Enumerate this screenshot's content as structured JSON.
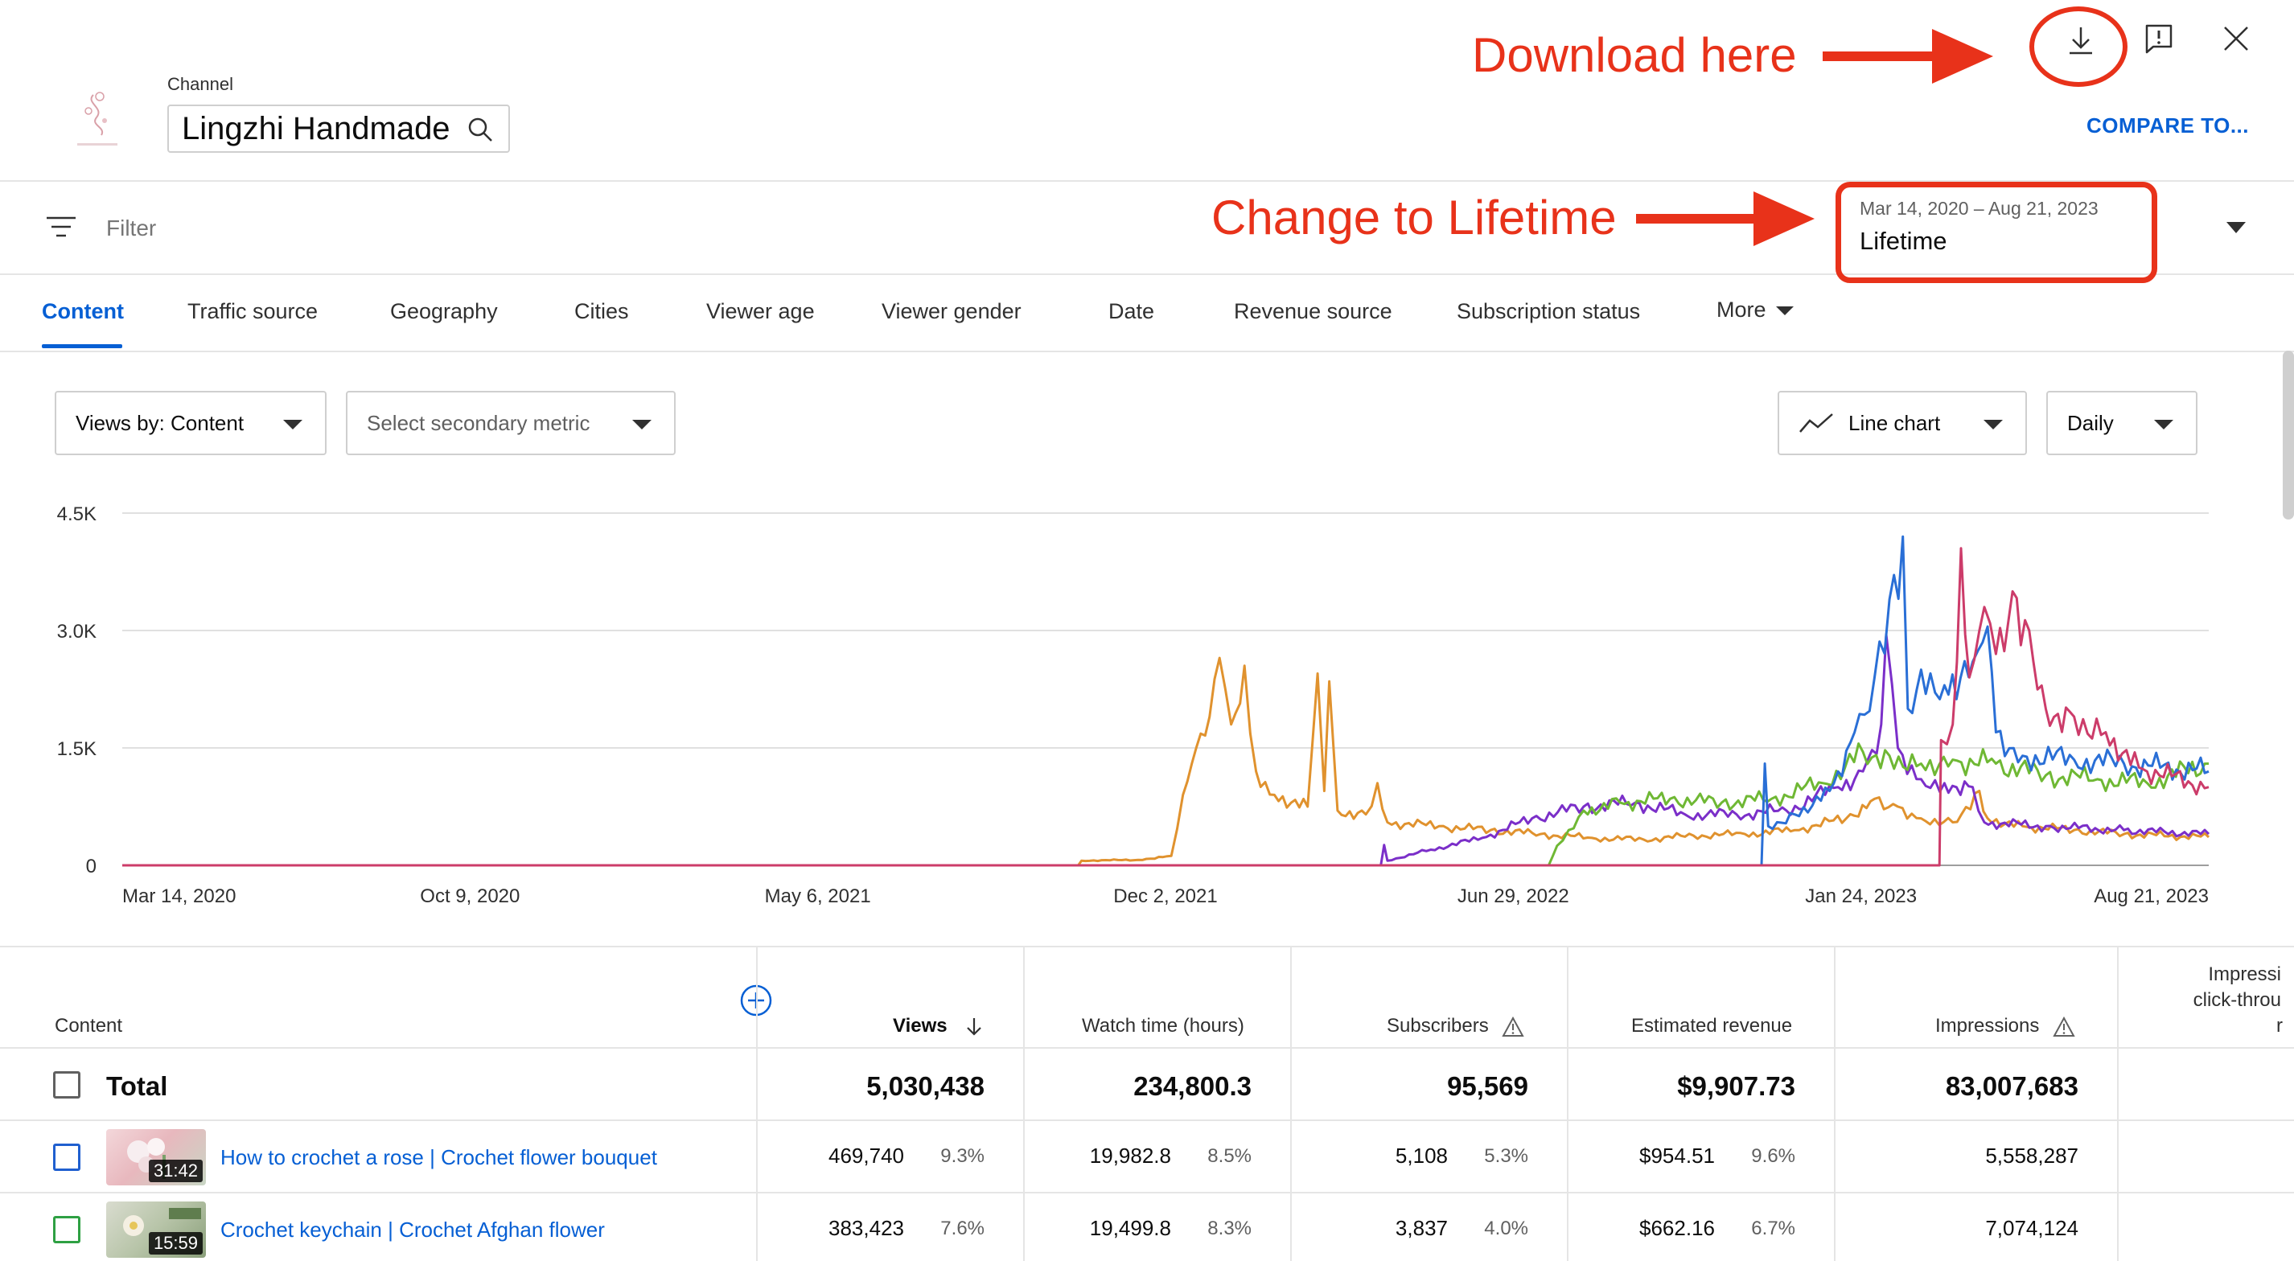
{
  "header": {
    "channel_caption": "Channel",
    "channel_name": "Lingzhi Handmade",
    "compare_label": "COMPARE TO..."
  },
  "annotations": {
    "download": "Download here",
    "lifetime": "Change to Lifetime"
  },
  "filterbar": {
    "filter_label": "Filter",
    "date_range": "Mar 14, 2020 – Aug 21, 2023",
    "date_value": "Lifetime"
  },
  "tabs": [
    {
      "label": "Content",
      "active": true
    },
    {
      "label": "Traffic source"
    },
    {
      "label": "Geography"
    },
    {
      "label": "Cities"
    },
    {
      "label": "Viewer age"
    },
    {
      "label": "Viewer gender"
    },
    {
      "label": "Date"
    },
    {
      "label": "Revenue source"
    },
    {
      "label": "Subscription status"
    },
    {
      "label": "More"
    }
  ],
  "controls": {
    "primary_metric": "Views by: Content",
    "secondary_metric": "Select secondary metric",
    "chart_type": "Line chart",
    "granularity": "Daily"
  },
  "colors": {
    "accent": "#065fd4",
    "annotation": "#e8321a",
    "series_orange": "#e0922e",
    "series_purple": "#7b2fc9",
    "series_green": "#6fb834",
    "series_blue": "#2a6fd6",
    "series_pink": "#cc3c6a"
  },
  "chart_data": {
    "type": "line",
    "x_tick_labels": [
      "Mar 14, 2020",
      "Oct 9, 2020",
      "May 6, 2021",
      "Dec 2, 2021",
      "Jun 29, 2022",
      "Jan 24, 2023",
      "Aug 21, 2023"
    ],
    "y_tick_labels": [
      "0",
      "1.5K",
      "3.0K",
      "4.5K"
    ],
    "ylim": [
      0,
      4500
    ],
    "x_range": [
      "2020-03-14",
      "2023-08-21"
    ],
    "grid": true,
    "series": [
      {
        "color": "orange",
        "points": [
          [
            "2020-03-14",
            0
          ],
          [
            "2021-10-10",
            0
          ],
          [
            "2021-10-12",
            60
          ],
          [
            "2021-11-15",
            70
          ],
          [
            "2021-12-05",
            120
          ],
          [
            "2021-12-12",
            900
          ],
          [
            "2021-12-20",
            1500
          ],
          [
            "2021-12-28",
            1900
          ],
          [
            "2022-01-03",
            2650
          ],
          [
            "2022-01-10",
            1800
          ],
          [
            "2022-01-18",
            2550
          ],
          [
            "2022-01-25",
            1200
          ],
          [
            "2022-02-05",
            900
          ],
          [
            "2022-02-25",
            750
          ],
          [
            "2022-03-03",
            2450
          ],
          [
            "2022-03-07",
            950
          ],
          [
            "2022-03-10",
            2350
          ],
          [
            "2022-03-15",
            700
          ],
          [
            "2022-04-01",
            650
          ],
          [
            "2022-04-08",
            1050
          ],
          [
            "2022-04-14",
            550
          ],
          [
            "2022-05-15",
            500
          ],
          [
            "2022-06-15",
            450
          ],
          [
            "2022-07-15",
            400
          ],
          [
            "2022-08-15",
            350
          ],
          [
            "2022-09-15",
            330
          ],
          [
            "2022-10-15",
            380
          ],
          [
            "2022-11-15",
            400
          ],
          [
            "2022-12-15",
            450
          ],
          [
            "2023-01-15",
            600
          ],
          [
            "2023-02-01",
            850
          ],
          [
            "2023-02-15",
            750
          ],
          [
            "2023-03-01",
            600
          ],
          [
            "2023-03-20",
            550
          ],
          [
            "2023-04-05",
            950
          ],
          [
            "2023-04-10",
            600
          ],
          [
            "2023-05-01",
            500
          ],
          [
            "2023-06-01",
            450
          ],
          [
            "2023-07-01",
            400
          ],
          [
            "2023-08-21",
            360
          ]
        ]
      },
      {
        "color": "purple",
        "points": [
          [
            "2020-03-14",
            0
          ],
          [
            "2022-04-10",
            0
          ],
          [
            "2022-04-12",
            260
          ],
          [
            "2022-04-14",
            60
          ],
          [
            "2022-05-10",
            200
          ],
          [
            "2022-06-10",
            350
          ],
          [
            "2022-07-10",
            600
          ],
          [
            "2022-08-10",
            750
          ],
          [
            "2022-09-10",
            800
          ],
          [
            "2022-10-10",
            650
          ],
          [
            "2022-11-10",
            650
          ],
          [
            "2022-12-10",
            700
          ],
          [
            "2023-01-10",
            1000
          ],
          [
            "2023-01-25",
            1200
          ],
          [
            "2023-02-05",
            1800
          ],
          [
            "2023-02-08",
            2950
          ],
          [
            "2023-02-15",
            1500
          ],
          [
            "2023-03-01",
            1100
          ],
          [
            "2023-03-15",
            1050
          ],
          [
            "2023-04-01",
            1000
          ],
          [
            "2023-04-08",
            550
          ],
          [
            "2023-05-15",
            500
          ],
          [
            "2023-07-01",
            450
          ],
          [
            "2023-08-21",
            400
          ]
        ]
      },
      {
        "color": "green",
        "points": [
          [
            "2020-03-14",
            0
          ],
          [
            "2022-07-20",
            0
          ],
          [
            "2022-07-25",
            250
          ],
          [
            "2022-08-01",
            450
          ],
          [
            "2022-08-10",
            700
          ],
          [
            "2022-09-01",
            800
          ],
          [
            "2022-10-01",
            850
          ],
          [
            "2022-11-01",
            800
          ],
          [
            "2022-12-01",
            850
          ],
          [
            "2023-01-01",
            1050
          ],
          [
            "2023-01-25",
            1450
          ],
          [
            "2023-02-10",
            1400
          ],
          [
            "2023-03-01",
            1300
          ],
          [
            "2023-03-20",
            1350
          ],
          [
            "2023-04-15",
            1300
          ],
          [
            "2023-05-15",
            1150
          ],
          [
            "2023-06-15",
            1100
          ],
          [
            "2023-07-15",
            1050
          ],
          [
            "2023-08-21",
            1300
          ]
        ]
      },
      {
        "color": "blue",
        "points": [
          [
            "2020-03-14",
            0
          ],
          [
            "2022-11-25",
            0
          ],
          [
            "2022-11-27",
            1300
          ],
          [
            "2022-11-29",
            500
          ],
          [
            "2022-12-15",
            650
          ],
          [
            "2023-01-05",
            950
          ],
          [
            "2023-01-20",
            1700
          ],
          [
            "2023-02-01",
            2400
          ],
          [
            "2023-02-10",
            3400
          ],
          [
            "2023-02-18",
            4200
          ],
          [
            "2023-02-21",
            2000
          ],
          [
            "2023-03-01",
            2500
          ],
          [
            "2023-03-15",
            2300
          ],
          [
            "2023-04-01",
            2600
          ],
          [
            "2023-04-10",
            3050
          ],
          [
            "2023-04-15",
            1700
          ],
          [
            "2023-05-01",
            1400
          ],
          [
            "2023-06-01",
            1350
          ],
          [
            "2023-07-01",
            1300
          ],
          [
            "2023-08-21",
            1200
          ]
        ]
      },
      {
        "color": "pink",
        "points": [
          [
            "2020-03-14",
            0
          ],
          [
            "2023-03-12",
            0
          ],
          [
            "2023-03-13",
            1600
          ],
          [
            "2023-03-20",
            1800
          ],
          [
            "2023-03-25",
            4050
          ],
          [
            "2023-03-30",
            2400
          ],
          [
            "2023-04-08",
            3300
          ],
          [
            "2023-04-15",
            2700
          ],
          [
            "2023-04-25",
            3500
          ],
          [
            "2023-05-05",
            3000
          ],
          [
            "2023-05-15",
            2000
          ],
          [
            "2023-06-01",
            1900
          ],
          [
            "2023-06-20",
            1700
          ],
          [
            "2023-07-10",
            1250
          ],
          [
            "2023-08-21",
            1000
          ]
        ]
      }
    ]
  },
  "table": {
    "headers": {
      "content": "Content",
      "views": "Views",
      "watch_time": "Watch time (hours)",
      "subscribers": "Subscribers",
      "revenue": "Estimated revenue",
      "impressions": "Impressions",
      "ctr_line1": "Impressi",
      "ctr_line2": "click-throu",
      "ctr_line3": "r"
    },
    "total": {
      "label": "Total",
      "views": "5,030,438",
      "watch_time": "234,800.3",
      "subscribers": "95,569",
      "revenue": "$9,907.73",
      "impressions": "83,007,683"
    },
    "rows": [
      {
        "title": "How to crochet a rose | Crochet flower bouquet",
        "duration": "31:42",
        "views": "469,740",
        "views_pct": "9.3%",
        "watch_time": "19,982.8",
        "watch_pct": "8.5%",
        "subscribers": "5,108",
        "subs_pct": "5.3%",
        "revenue": "$954.51",
        "revenue_pct": "9.6%",
        "impressions": "5,558,287"
      },
      {
        "title": "Crochet keychain | Crochet Afghan flower",
        "duration": "15:59",
        "views": "383,423",
        "views_pct": "7.6%",
        "watch_time": "19,499.8",
        "watch_pct": "8.3%",
        "subscribers": "3,837",
        "subs_pct": "4.0%",
        "revenue": "$662.16",
        "revenue_pct": "6.7%",
        "impressions": "7,074,124"
      }
    ]
  }
}
